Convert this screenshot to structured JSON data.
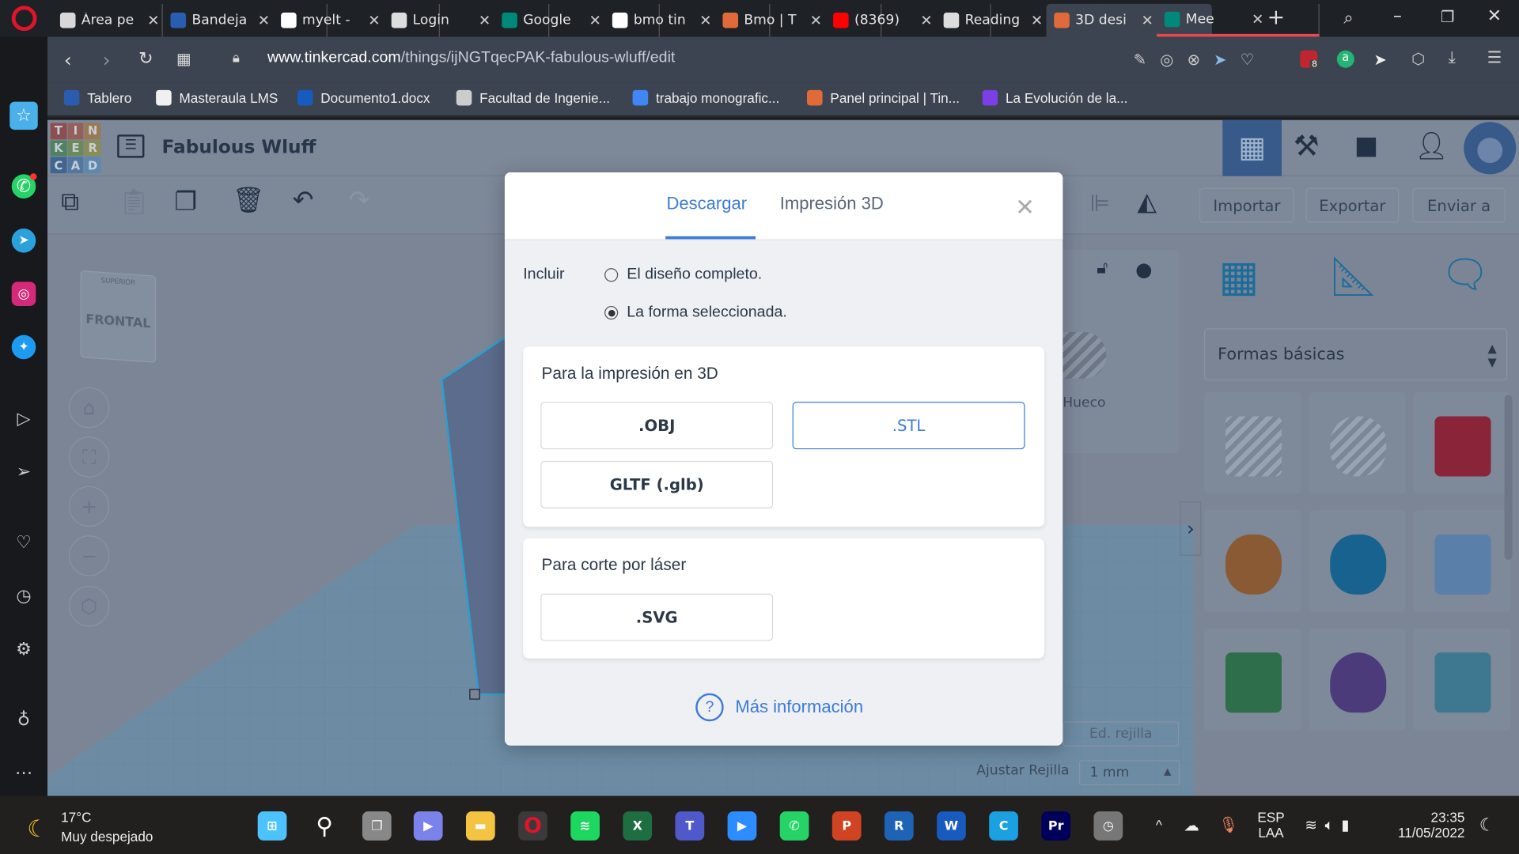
{
  "browser": {
    "tabs": [
      {
        "label": "Área pe",
        "icon": "graduation-icon",
        "color": "#d8d8d8"
      },
      {
        "label": "Bandeja",
        "icon": "university-icon",
        "color": "#2a5db0"
      },
      {
        "label": "myelt -",
        "icon": "google-icon",
        "color": "#ffffff"
      },
      {
        "label": "Login",
        "icon": "globe-icon",
        "color": "#dddddd"
      },
      {
        "label": "Google",
        "icon": "meet-icon",
        "color": "#00897b"
      },
      {
        "label": "bmo tin",
        "icon": "google-icon",
        "color": "#ffffff"
      },
      {
        "label": "Bmo | T",
        "icon": "tinkercad-icon",
        "color": "#e06a3a"
      },
      {
        "label": "(8369)",
        "icon": "youtube-icon",
        "color": "#ff0000"
      },
      {
        "label": "Reading",
        "icon": "globe-icon",
        "color": "#dddddd"
      },
      {
        "label": "3D desi",
        "icon": "tinkercad-icon",
        "color": "#e06a3a",
        "active": true
      },
      {
        "label": "Mee",
        "icon": "meet-icon",
        "color": "#00897b"
      }
    ],
    "url_domain": "www.tinkercad.com",
    "url_path": "/things/ijNGTqecPAK-fabulous-wluff/edit",
    "bookmarks": [
      {
        "label": "Tablero",
        "color": "#2a5db0"
      },
      {
        "label": "Masteraula LMS",
        "color": "#f0f0f0"
      },
      {
        "label": "Documento1.docx",
        "color": "#185abd"
      },
      {
        "label": "Facultad de Ingenie...",
        "color": "#cccccc"
      },
      {
        "label": "trabajo monografic...",
        "color": "#4285f4"
      },
      {
        "label": "Panel principal | Tin...",
        "color": "#e06a3a"
      },
      {
        "label": "La Evolución de la...",
        "color": "#7b3fe4"
      }
    ],
    "badge_count": "8"
  },
  "app": {
    "logo_letters": [
      "T",
      "I",
      "N",
      "K",
      "E",
      "R",
      "C",
      "A",
      "D"
    ],
    "title": "Fabulous Wluff",
    "toolbar": {
      "import": "Importar",
      "export": "Exportar",
      "send": "Enviar a"
    },
    "viewcube": {
      "top": "SUPERIOR",
      "front": "FRONTAL"
    },
    "inspector": {
      "hole_label": "Hueco"
    },
    "grid": {
      "edit": "Ed. rejilla",
      "snap_label": "Ajustar Rejilla",
      "snap_value": "1 mm"
    },
    "shapes_category": "Formas básicas",
    "shapes": [
      {
        "name": "box-hole",
        "color": "#8d99ab"
      },
      {
        "name": "cylinder-hole",
        "color": "#8d99ab"
      },
      {
        "name": "box",
        "color": "#8a2438"
      },
      {
        "name": "cylinder",
        "color": "#8a5a34"
      },
      {
        "name": "sphere",
        "color": "#17628f"
      },
      {
        "name": "scribble",
        "color": "#5a7fa8"
      },
      {
        "name": "roof",
        "color": "#2e6e4a"
      },
      {
        "name": "cone",
        "color": "#4b3b7a"
      },
      {
        "name": "round-roof",
        "color": "#3e7890"
      }
    ]
  },
  "dialog": {
    "tabs": [
      {
        "label": "Descargar",
        "active": true
      },
      {
        "label": "Impresión 3D"
      }
    ],
    "include_label": "Incluir",
    "options": [
      {
        "label": "El diseño completo.",
        "selected": false
      },
      {
        "label": "La forma seleccionada.",
        "selected": true
      }
    ],
    "print_section": {
      "title": "Para la impresión en 3D",
      "buttons": [
        ".OBJ",
        ".STL",
        "GLTF (.glb)"
      ]
    },
    "laser_section": {
      "title": "Para corte por láser",
      "buttons": [
        ".SVG"
      ]
    },
    "more_info": "Más información",
    "accent": "#3c7bd8"
  },
  "taskbar": {
    "weather_temp": "17°C",
    "weather_desc": "Muy despejado",
    "lang1": "ESP",
    "lang2": "LAA",
    "time": "23:35",
    "date": "11/05/2022"
  }
}
